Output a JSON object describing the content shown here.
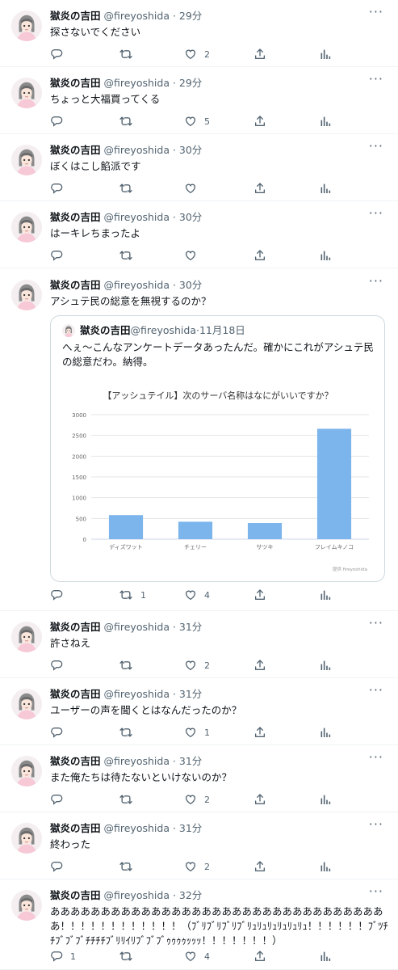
{
  "user": {
    "name": "獄炎の吉田",
    "handle": "@fireyoshida",
    "more_icon": "more-icon"
  },
  "colors": {
    "text": "#0f1419",
    "muted": "#536471",
    "border": "#eff3f4",
    "bar": "#7cb5ec"
  },
  "tweets": [
    {
      "time": "29分",
      "text": "探さないでください",
      "reply": "",
      "retweet": "",
      "like": "2"
    },
    {
      "time": "29分",
      "text": "ちょっと大福買ってくる",
      "reply": "",
      "retweet": "",
      "like": "5"
    },
    {
      "time": "30分",
      "text": "ぼくはこし餡派です",
      "reply": "",
      "retweet": "",
      "like": ""
    },
    {
      "time": "30分",
      "text": "はーキレちまったよ",
      "reply": "",
      "retweet": "",
      "like": ""
    },
    {
      "time": "30分",
      "text": "アシュテ民の総意を無視するのか？",
      "reply": "",
      "retweet": "1",
      "like": "4"
    },
    {
      "time": "31分",
      "text": "許さねえ",
      "reply": "",
      "retweet": "",
      "like": "2"
    },
    {
      "time": "31分",
      "text": "ユーザーの声を聞くとはなんだったのか？",
      "reply": "",
      "retweet": "",
      "like": "1"
    },
    {
      "time": "31分",
      "text": "また俺たちは待たないといけないのか？",
      "reply": "",
      "retweet": "",
      "like": "2"
    },
    {
      "time": "31分",
      "text": "終わった",
      "reply": "",
      "retweet": "",
      "like": "2"
    },
    {
      "time": "32分",
      "text": "ああああああああああああああああああああああああああああああああああ！！！！！！！！！！！！（ﾌﾞﾘﾌﾞﾘﾌﾞﾘﾌﾞﾘｭﾘｭﾘｭﾘｭﾘｭﾘｭ！！！！！！ﾌﾞﾂﾁﾁﾌﾞﾌﾞﾌﾞﾁﾁﾁﾁﾌﾞﾘﾘｲﾘﾌﾞﾌﾞﾌﾞｩｩｩｩｯｯｯ！！！！！！！）",
      "reply": "1",
      "retweet": "",
      "like": "4"
    }
  ],
  "quote": {
    "name": "獄炎の吉田",
    "handle": "@fireyoshida",
    "date": "11月18日",
    "text": "へぇ～こんなアンケートデータあったんだ。確かにこれがアシュテ民の総意だわ。納得。"
  },
  "chart_data": {
    "type": "bar",
    "title": "【アッシュテイル】次のサーバ名称はなにがいいですか？",
    "categories": [
      "ディズワット",
      "チェリー",
      "サツキ",
      "フレイムキノコ"
    ],
    "values": [
      580,
      420,
      390,
      2660
    ],
    "yticks": [
      "0",
      "500",
      "1000",
      "1500",
      "2000",
      "2500",
      "3000"
    ],
    "ylim": [
      0,
      3000
    ],
    "grid": true,
    "credit": "提供 fireyoshida"
  }
}
